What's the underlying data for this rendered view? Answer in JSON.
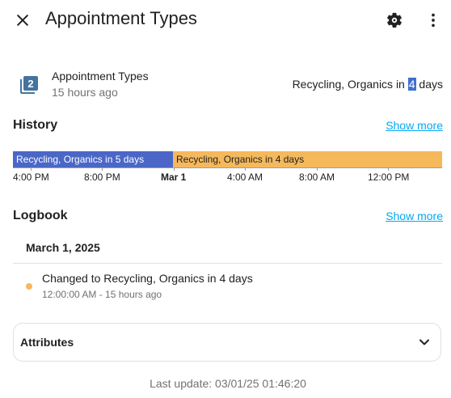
{
  "header": {
    "title": "Appointment Types",
    "close_icon": "close-icon",
    "settings_icon": "gear-icon",
    "more_icon": "more-vertical-icon"
  },
  "entity": {
    "name": "Appointment Types",
    "last_changed": "15 hours ago",
    "state_prefix": "Recycling, Organics in ",
    "state_highlight": "4",
    "state_suffix": " days",
    "icon": "numeric-2-box-multiple-icon",
    "icon_color": "#44739e"
  },
  "history": {
    "title": "History",
    "show_more": "Show more",
    "segments": [
      {
        "label": "Recycling, Organics in 5 days",
        "color": "#4a67c8"
      },
      {
        "label": "Recycling, Organics in 4 days",
        "color": "#f5b95c"
      }
    ],
    "ticks": [
      "4:00 PM",
      "8:00 PM",
      "Mar 1",
      "4:00 AM",
      "8:00 AM",
      "12:00 PM"
    ]
  },
  "logbook": {
    "title": "Logbook",
    "show_more": "Show more",
    "date": "March 1, 2025",
    "entries": [
      {
        "message": "Changed to Recycling, Organics in 4 days",
        "time": "12:00:00 AM - 15 hours ago",
        "dot_color": "#f5b95c"
      }
    ]
  },
  "attributes": {
    "label": "Attributes",
    "icon": "chevron-down-icon"
  },
  "footer": {
    "last_update": "Last update: 03/01/25 01:46:20"
  },
  "colors": {
    "link": "#03a9f4",
    "divider": "#e0e0e0",
    "highlight": "#3f6fd1"
  }
}
